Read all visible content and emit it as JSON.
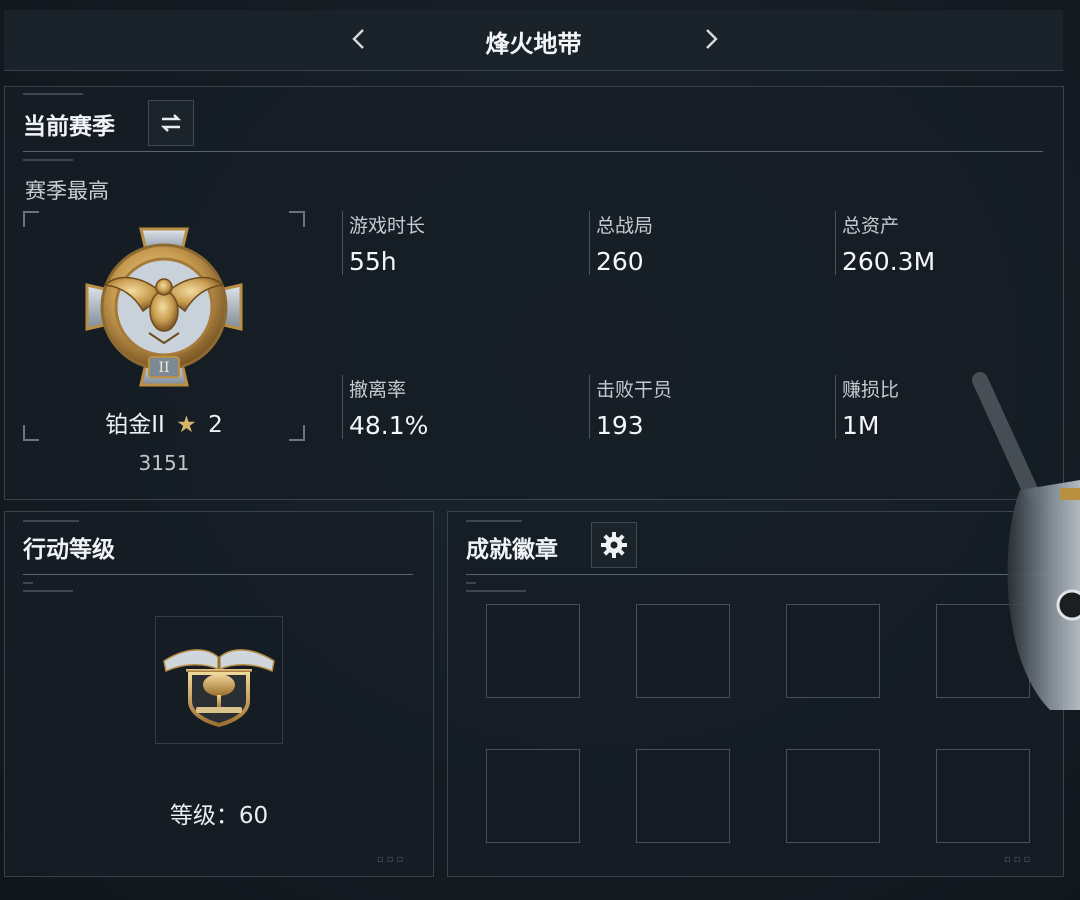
{
  "header": {
    "title": "烽火地带"
  },
  "season": {
    "title": "当前赛季",
    "best_label": "赛季最高",
    "rank_name": "铂金II",
    "rank_stars": "2",
    "rank_score": "3151",
    "medal_numeral": "II",
    "stats": [
      {
        "label": "游戏时长",
        "value": "55h"
      },
      {
        "label": "总战局",
        "value": "260"
      },
      {
        "label": "总资产",
        "value": "260.3M"
      },
      {
        "label": "撤离率",
        "value": "48.1%"
      },
      {
        "label": "击败干员",
        "value": "193"
      },
      {
        "label": "赚损比",
        "value": "1M"
      }
    ]
  },
  "rank": {
    "title": "行动等级",
    "level_text": "等级：60"
  },
  "achievements": {
    "title": "成就徽章",
    "slots": 8
  },
  "colors": {
    "background": "#141b22",
    "panel_border": "#39424b",
    "gold": "#d6b56b"
  },
  "icons": [
    "chevron-left-icon",
    "chevron-right-icon",
    "swap-icon",
    "gear-icon",
    "star-icon"
  ]
}
